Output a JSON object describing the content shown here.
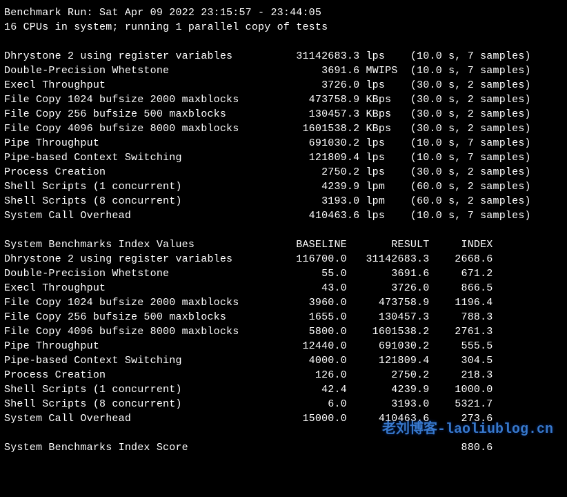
{
  "header": {
    "run_line": "Benchmark Run: Sat Apr 09 2022 23:15:57 - 23:44:05",
    "cpu_line": "16 CPUs in system; running 1 parallel copy of tests"
  },
  "results": [
    {
      "name": "Dhrystone 2 using register variables",
      "value": "31142683.3",
      "unit": "lps",
      "timing": "(10.0 s, 7 samples)"
    },
    {
      "name": "Double-Precision Whetstone",
      "value": "3691.6",
      "unit": "MWIPS",
      "timing": "(10.0 s, 7 samples)"
    },
    {
      "name": "Execl Throughput",
      "value": "3726.0",
      "unit": "lps",
      "timing": "(30.0 s, 2 samples)"
    },
    {
      "name": "File Copy 1024 bufsize 2000 maxblocks",
      "value": "473758.9",
      "unit": "KBps",
      "timing": "(30.0 s, 2 samples)"
    },
    {
      "name": "File Copy 256 bufsize 500 maxblocks",
      "value": "130457.3",
      "unit": "KBps",
      "timing": "(30.0 s, 2 samples)"
    },
    {
      "name": "File Copy 4096 bufsize 8000 maxblocks",
      "value": "1601538.2",
      "unit": "KBps",
      "timing": "(30.0 s, 2 samples)"
    },
    {
      "name": "Pipe Throughput",
      "value": "691030.2",
      "unit": "lps",
      "timing": "(10.0 s, 7 samples)"
    },
    {
      "name": "Pipe-based Context Switching",
      "value": "121809.4",
      "unit": "lps",
      "timing": "(10.0 s, 7 samples)"
    },
    {
      "name": "Process Creation",
      "value": "2750.2",
      "unit": "lps",
      "timing": "(30.0 s, 2 samples)"
    },
    {
      "name": "Shell Scripts (1 concurrent)",
      "value": "4239.9",
      "unit": "lpm",
      "timing": "(60.0 s, 2 samples)"
    },
    {
      "name": "Shell Scripts (8 concurrent)",
      "value": "3193.0",
      "unit": "lpm",
      "timing": "(60.0 s, 2 samples)"
    },
    {
      "name": "System Call Overhead",
      "value": "410463.6",
      "unit": "lps",
      "timing": "(10.0 s, 7 samples)"
    }
  ],
  "index_header": {
    "title": "System Benchmarks Index Values",
    "col1": "BASELINE",
    "col2": "RESULT",
    "col3": "INDEX"
  },
  "index_rows": [
    {
      "name": "Dhrystone 2 using register variables",
      "baseline": "116700.0",
      "result": "31142683.3",
      "index": "2668.6"
    },
    {
      "name": "Double-Precision Whetstone",
      "baseline": "55.0",
      "result": "3691.6",
      "index": "671.2"
    },
    {
      "name": "Execl Throughput",
      "baseline": "43.0",
      "result": "3726.0",
      "index": "866.5"
    },
    {
      "name": "File Copy 1024 bufsize 2000 maxblocks",
      "baseline": "3960.0",
      "result": "473758.9",
      "index": "1196.4"
    },
    {
      "name": "File Copy 256 bufsize 500 maxblocks",
      "baseline": "1655.0",
      "result": "130457.3",
      "index": "788.3"
    },
    {
      "name": "File Copy 4096 bufsize 8000 maxblocks",
      "baseline": "5800.0",
      "result": "1601538.2",
      "index": "2761.3"
    },
    {
      "name": "Pipe Throughput",
      "baseline": "12440.0",
      "result": "691030.2",
      "index": "555.5"
    },
    {
      "name": "Pipe-based Context Switching",
      "baseline": "4000.0",
      "result": "121809.4",
      "index": "304.5"
    },
    {
      "name": "Process Creation",
      "baseline": "126.0",
      "result": "2750.2",
      "index": "218.3"
    },
    {
      "name": "Shell Scripts (1 concurrent)",
      "baseline": "42.4",
      "result": "4239.9",
      "index": "1000.0"
    },
    {
      "name": "Shell Scripts (8 concurrent)",
      "baseline": "6.0",
      "result": "3193.0",
      "index": "5321.7"
    },
    {
      "name": "System Call Overhead",
      "baseline": "15000.0",
      "result": "410463.6",
      "index": "273.6"
    }
  ],
  "score": {
    "label": "System Benchmarks Index Score",
    "value": "880.6"
  },
  "watermark": "老刘博客-laoliublog.cn"
}
